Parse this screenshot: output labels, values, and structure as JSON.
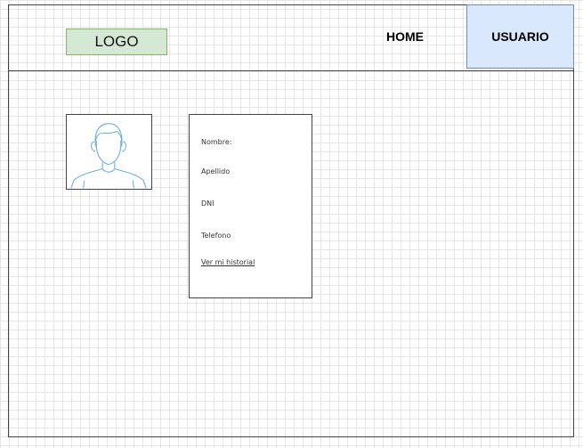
{
  "header": {
    "logo_label": "LOGO",
    "nav": {
      "home_label": "HOME",
      "usuario_label": "USUARIO"
    }
  },
  "profile": {
    "avatar_icon": "user-avatar-icon",
    "fields": {
      "nombre_label": "Nombre:",
      "apellido_label": "Apellido",
      "dni_label": "DNI",
      "telefono_label": "Telefono"
    },
    "history_link_label": "Ver mi historial"
  },
  "colors": {
    "logo_fill": "#d5e8d4",
    "logo_border": "#82b366",
    "active_nav_fill": "#dae8fc",
    "active_nav_border": "#6c8ebf",
    "avatar_stroke": "#5aa9d6"
  }
}
